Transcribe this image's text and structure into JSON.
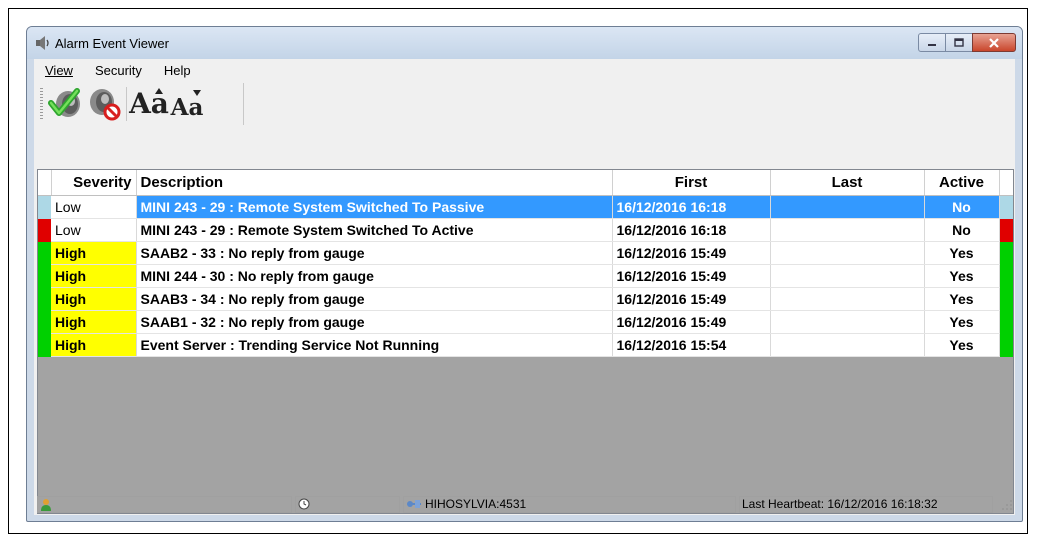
{
  "window": {
    "title": "Alarm Event Viewer"
  },
  "menu": {
    "items": [
      {
        "label": "View"
      },
      {
        "label": "Security"
      },
      {
        "label": "Help"
      }
    ]
  },
  "toolbar": {
    "icons": [
      "acknowledge-alarm-icon",
      "silence-alarm-icon",
      "increase-font-icon",
      "decrease-font-icon"
    ],
    "font_large_glyph": "Aa",
    "font_small_glyph": "Aa"
  },
  "grid": {
    "headers": {
      "severity": "Severity",
      "description": "Description",
      "first": "First",
      "last": "Last",
      "active": "Active"
    },
    "rows": [
      {
        "severity": "Low",
        "description": "MINI 243 - 29 : Remote System Switched To Passive",
        "first": "16/12/2016 16:18",
        "last": "",
        "active": "No",
        "indicator_color": "#add8e6",
        "selected": true
      },
      {
        "severity": "Low",
        "description": "MINI 243 - 29 : Remote System Switched To Active",
        "first": "16/12/2016 16:18",
        "last": "",
        "active": "No",
        "indicator_color": "#e00000",
        "selected": false
      },
      {
        "severity": "High",
        "description": "SAAB2 - 33 : No reply from gauge",
        "first": "16/12/2016 15:49",
        "last": "",
        "active": "Yes",
        "indicator_color": "#00d000",
        "selected": false
      },
      {
        "severity": "High",
        "description": "MINI 244 - 30 : No reply from gauge",
        "first": "16/12/2016 15:49",
        "last": "",
        "active": "Yes",
        "indicator_color": "#00d000",
        "selected": false
      },
      {
        "severity": "High",
        "description": "SAAB3 - 34 : No reply from gauge",
        "first": "16/12/2016 15:49",
        "last": "",
        "active": "Yes",
        "indicator_color": "#00d000",
        "selected": false
      },
      {
        "severity": "High",
        "description": "SAAB1 - 32 : No reply from gauge",
        "first": "16/12/2016 15:49",
        "last": "",
        "active": "Yes",
        "indicator_color": "#00d000",
        "selected": false
      },
      {
        "severity": "High",
        "description": "Event Server : Trending Service Not Running",
        "first": "16/12/2016 15:54",
        "last": "",
        "active": "Yes",
        "indicator_color": "#00d000",
        "selected": false
      }
    ]
  },
  "status": {
    "server": "HIHOSYLVIA:4531",
    "heartbeat": "Last Heartbeat: 16/12/2016 16:18:32"
  },
  "colors": {
    "selection": "#3399ff",
    "high_severity_bg": "#ffff00",
    "empty_grid_bg": "#a3a3a3"
  }
}
